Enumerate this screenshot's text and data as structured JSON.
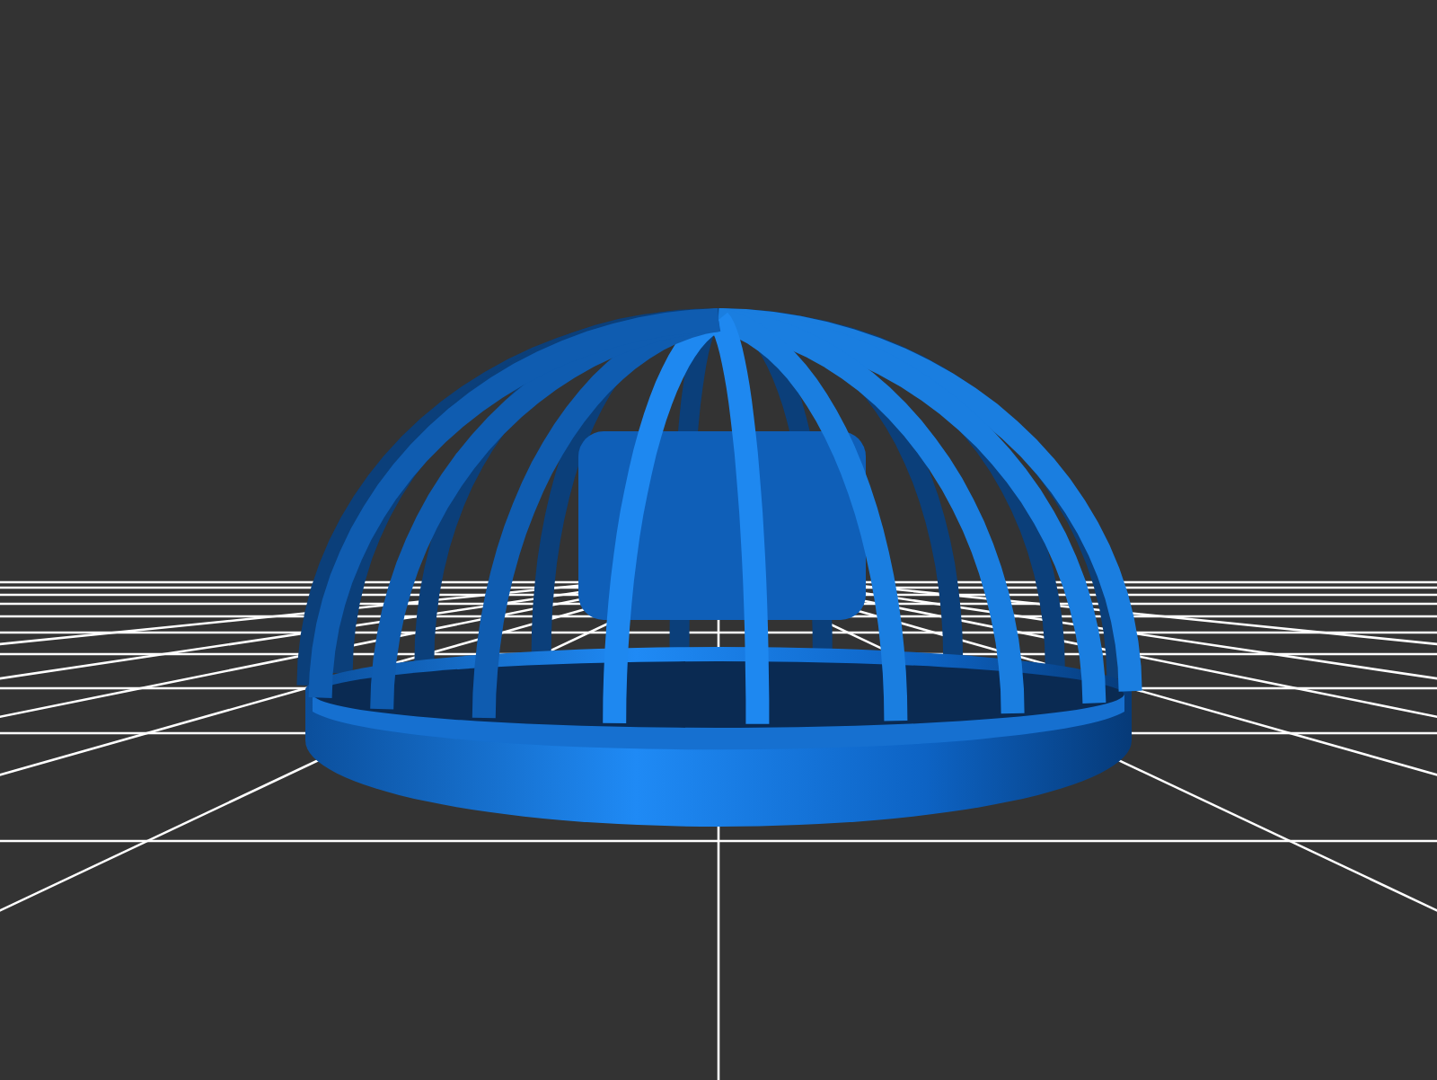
{
  "viewport": {
    "kind": "dome-cage"
  }
}
